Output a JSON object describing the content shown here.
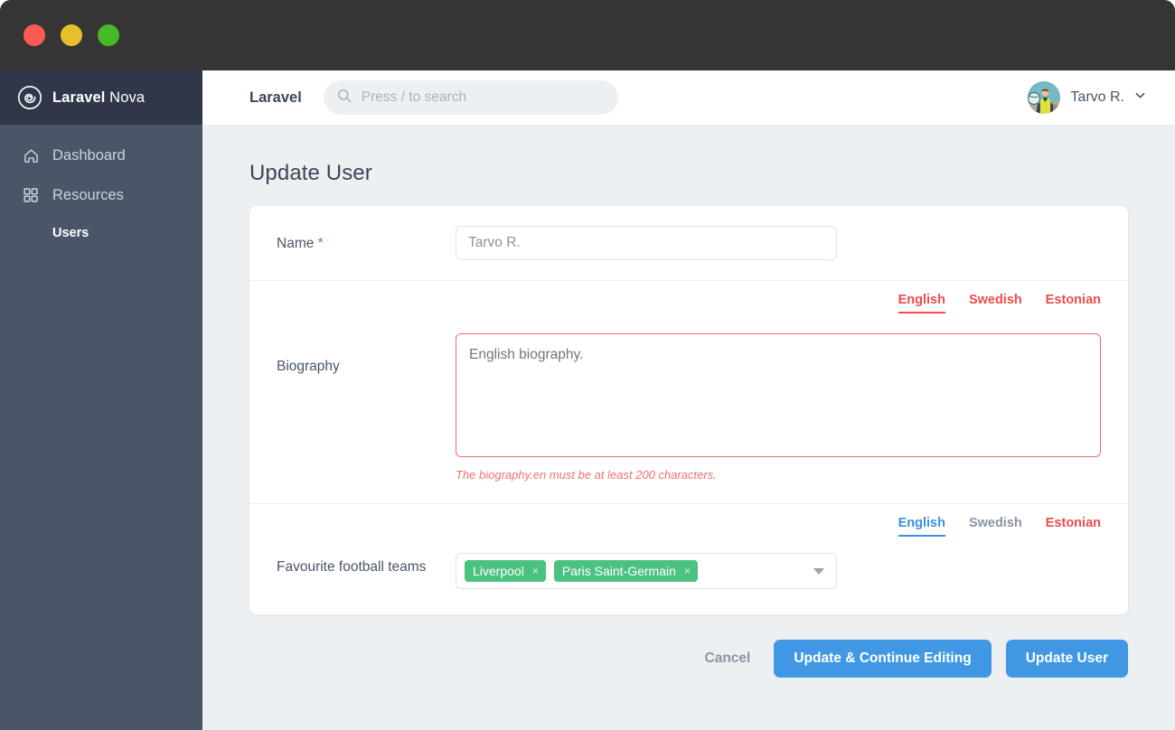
{
  "window": {
    "controls": [
      {
        "name": "close",
        "color": "#fc5b55"
      },
      {
        "name": "minimize",
        "color": "#e8c02c"
      },
      {
        "name": "zoom",
        "color": "#45ba26"
      }
    ]
  },
  "sidebar": {
    "brand_bold": "Laravel",
    "brand_light": " Nova",
    "items": [
      {
        "label": "Dashboard",
        "icon": "home-icon"
      },
      {
        "label": "Resources",
        "icon": "grid-icon"
      }
    ],
    "sub_items": [
      {
        "label": "Users"
      }
    ]
  },
  "topbar": {
    "title": "Laravel",
    "search": {
      "placeholder": "Press / to search",
      "value": "",
      "icon": "search-icon"
    },
    "user": {
      "name": "Tarvo R.",
      "caret": "chevron-down-icon"
    }
  },
  "page": {
    "title": "Update User"
  },
  "form": {
    "name_field": {
      "label": "Name",
      "required_marker": "*",
      "value": "Tarvo R.",
      "placeholder": "Tarvo R."
    },
    "biography_field": {
      "label": "Biography",
      "value": "English biography.",
      "placeholder": "English biography.",
      "error": "The biography.en must be at least 200 characters.",
      "locales": [
        {
          "label": "English",
          "state": "active-error"
        },
        {
          "label": "Swedish",
          "state": "error"
        },
        {
          "label": "Estonian",
          "state": "error"
        }
      ]
    },
    "teams_field": {
      "label": "Favourite football teams",
      "tags": [
        {
          "label": "Liverpool",
          "remove": "×"
        },
        {
          "label": "Paris Saint-Germain",
          "remove": "×"
        }
      ],
      "caret": "chevron-down-icon",
      "locales": [
        {
          "label": "English",
          "state": "active"
        },
        {
          "label": "Swedish",
          "state": "normal"
        },
        {
          "label": "Estonian",
          "state": "error"
        }
      ]
    }
  },
  "actions": {
    "cancel": "Cancel",
    "update_continue": "Update & Continue Editing",
    "update": "Update User"
  },
  "colors": {
    "accent_blue": "#4098e4",
    "error_red": "#ef4b4b",
    "tag_green": "#4cc281",
    "sidebar": "#4a5568",
    "sidebar_dark": "#2f3748",
    "page_bg": "#edf0f2"
  }
}
